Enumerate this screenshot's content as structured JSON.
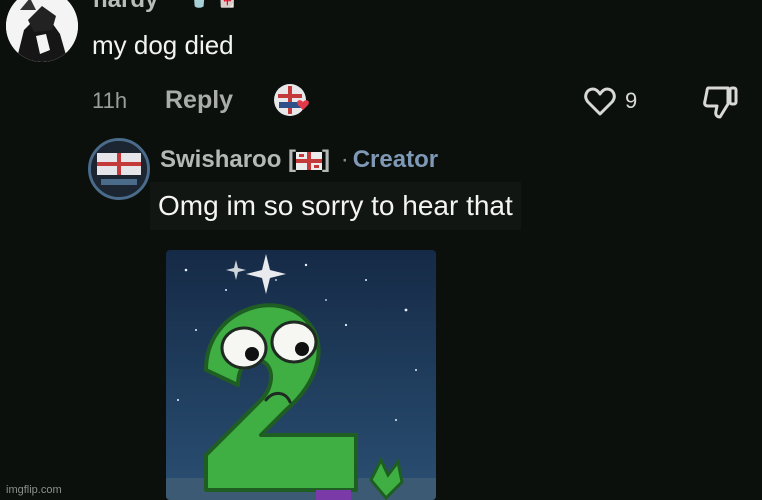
{
  "comment": {
    "username": "hardy",
    "flair": "🥤🀄",
    "text": "my dog died",
    "time": "11h",
    "reply_label": "Reply",
    "likes": "9"
  },
  "reply": {
    "username": "Swisharoo",
    "flag_open": "[",
    "flag_close": "]",
    "dot": "·",
    "badge": "Creator",
    "text": "Omg im so sorry to hear that",
    "image_icon": "sad-green-number-two-character"
  },
  "watermark": "imgflip.com",
  "colors": {
    "background": "#0b100d",
    "creator_accent": "#7f98b5",
    "heart_red": "#e0394a"
  }
}
